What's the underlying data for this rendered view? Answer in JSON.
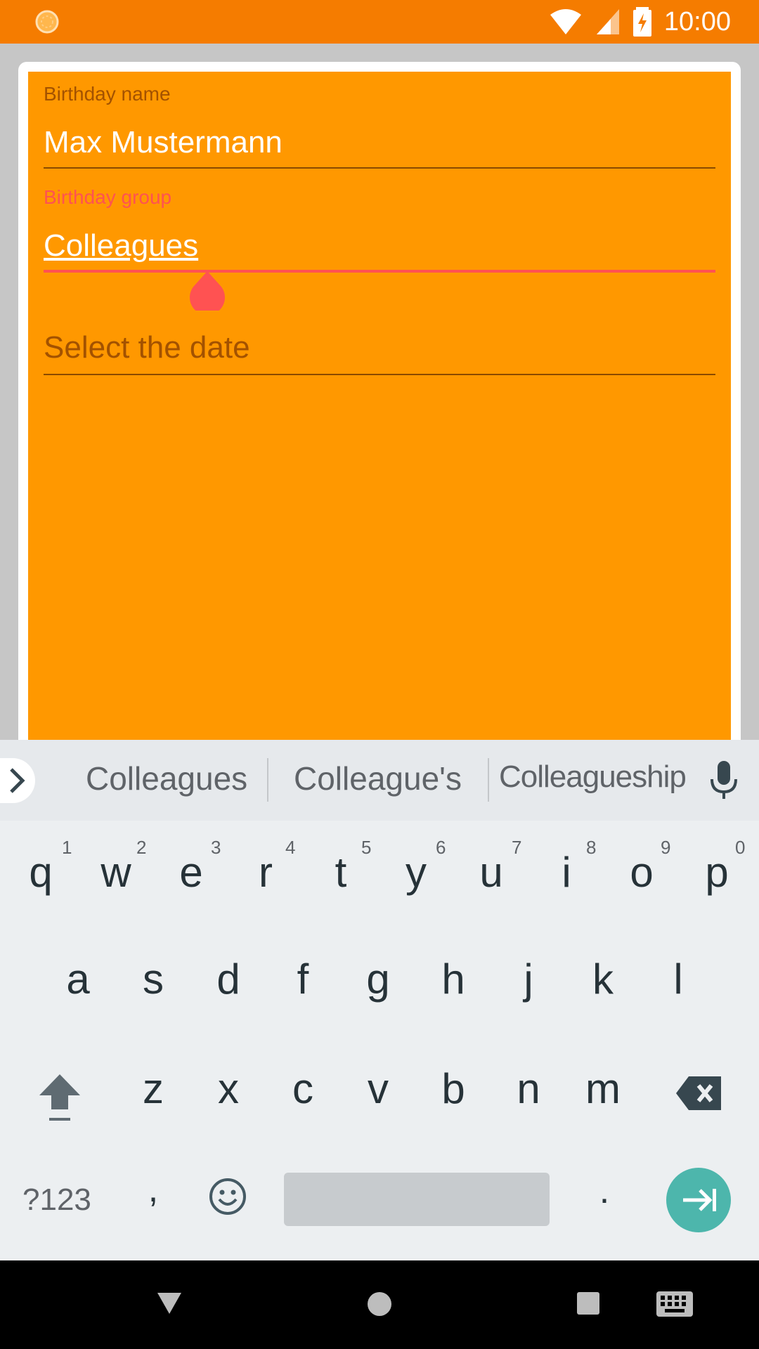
{
  "status_bar": {
    "time": "10:00",
    "icons": [
      "app-loading-icon",
      "wifi-icon",
      "cellular-icon",
      "battery-charging-icon"
    ]
  },
  "form": {
    "name_label": "Birthday name",
    "name_value": "Max Mustermann",
    "group_label": "Birthday group",
    "group_value": "Colleagues",
    "date_placeholder": "Select the date"
  },
  "keyboard": {
    "suggestions": [
      "Colleagues",
      "Colleague's",
      "Colleagueship"
    ],
    "row1": [
      "q",
      "w",
      "e",
      "r",
      "t",
      "y",
      "u",
      "i",
      "o",
      "p"
    ],
    "row1_numbers": [
      "1",
      "2",
      "3",
      "4",
      "5",
      "6",
      "7",
      "8",
      "9",
      "0"
    ],
    "row2": [
      "a",
      "s",
      "d",
      "f",
      "g",
      "h",
      "j",
      "k",
      "l"
    ],
    "row3": [
      "z",
      "x",
      "c",
      "v",
      "b",
      "n",
      "m"
    ],
    "symbols_label": "?123",
    "comma": ",",
    "period": "."
  },
  "colors": {
    "status_bar": "#f57c00",
    "form_background": "#ff9800",
    "accent_error": "#ff5252",
    "enter_key": "#4db6ac"
  }
}
